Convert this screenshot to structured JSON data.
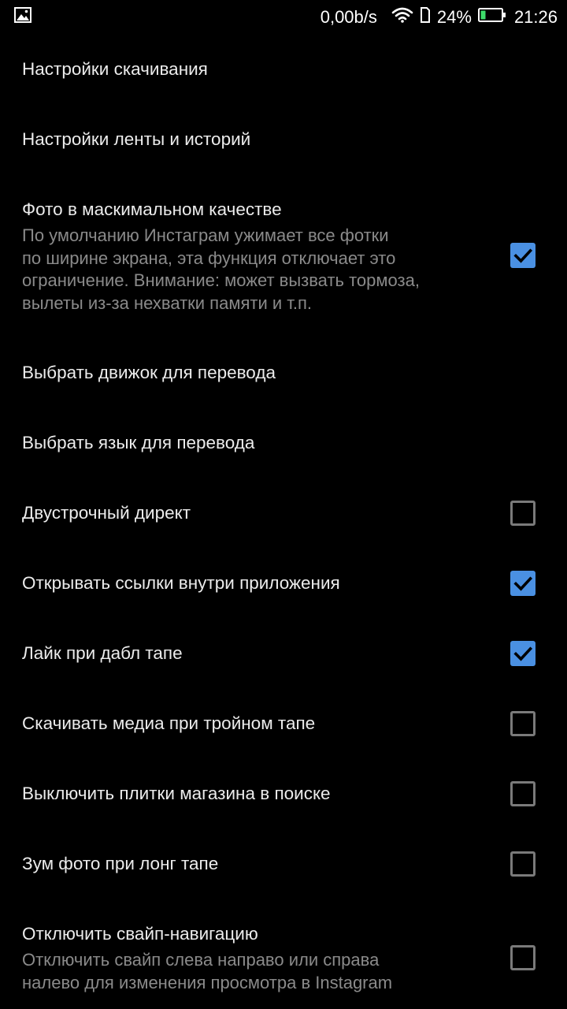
{
  "status_bar": {
    "network_speed": "0,00b/s",
    "battery_percent": "24%",
    "battery_level": 0.24,
    "time": "21:26"
  },
  "colors": {
    "background": "#000000",
    "title_text": "#ECECEC",
    "summary_text": "#8A8A8A",
    "checkbox_checked": "#4A90E2",
    "checkbox_unchecked_border": "#7A7A7A",
    "battery_fill": "#3DDC6A"
  },
  "settings": [
    {
      "title": "Настройки скачивания"
    },
    {
      "title": "Настройки ленты и историй"
    },
    {
      "title": "Фото в маскимальном качестве",
      "summary_lines": [
        "По умолчанию Инстаграм ужимает все фотки",
        "по ширине экрана, эта функция отключает это",
        "ограничение. Внимание: может вызвать тормоза,",
        "вылеты из-за нехватки памяти и т.п."
      ],
      "checked": true
    },
    {
      "title": "Выбрать движок для перевода"
    },
    {
      "title": "Выбрать язык для перевода"
    },
    {
      "title": "Двустрочный директ",
      "checked": false
    },
    {
      "title": "Открывать ссылки внутри приложения",
      "checked": true
    },
    {
      "title": "Лайк при дабл тапе",
      "checked": true
    },
    {
      "title": "Скачивать медиа при тройном тапе",
      "checked": false
    },
    {
      "title": "Выключить плитки магазина в поиске",
      "checked": false
    },
    {
      "title": "Зум фото при лонг тапе",
      "checked": false
    },
    {
      "title": "Отключить свайп-навигацию",
      "summary_lines": [
        "Отключить свайп слева направо или справа",
        "налево для изменения просмотра в Instagram"
      ],
      "checked": false
    }
  ]
}
